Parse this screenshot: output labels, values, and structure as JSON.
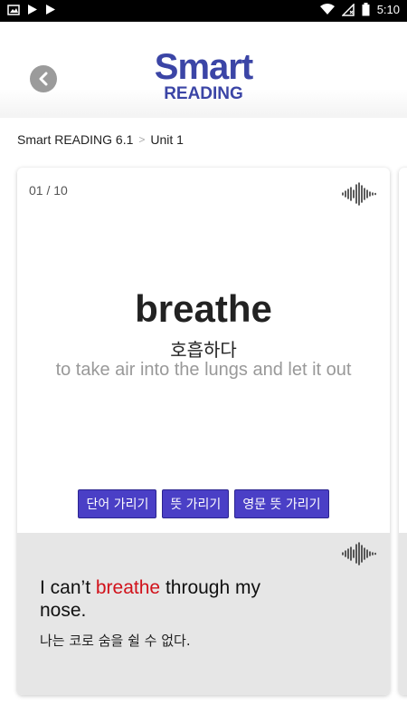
{
  "status": {
    "time": "5:10"
  },
  "header": {
    "logo_top": "Smart",
    "logo_bottom": "READING"
  },
  "breadcrumb": {
    "book": "Smart READING 6.1",
    "separator": ">",
    "unit": "Unit 1"
  },
  "card": {
    "counter": "01 / 10",
    "word": "breathe",
    "meaning_ko": "호흡하다",
    "definition": "to take air into the lungs and let it out",
    "buttons": [
      {
        "label": "단어 가리기"
      },
      {
        "label": "뜻 가리기"
      },
      {
        "label": "영문 뜻 가리기"
      }
    ],
    "example": {
      "en_before": "I can’t ",
      "en_highlight": "breathe",
      "en_after": " through my nose.",
      "ko": "나는 코로 숨을 쉴 수 없다."
    }
  },
  "colors": {
    "brand": "#3b45a6",
    "button_bg": "#4a3fc6",
    "highlight": "#d1121b",
    "example_bg": "#e6e6e6"
  },
  "icons": {
    "back": "back-arrow-icon",
    "audio": "sound-wave-icon"
  }
}
